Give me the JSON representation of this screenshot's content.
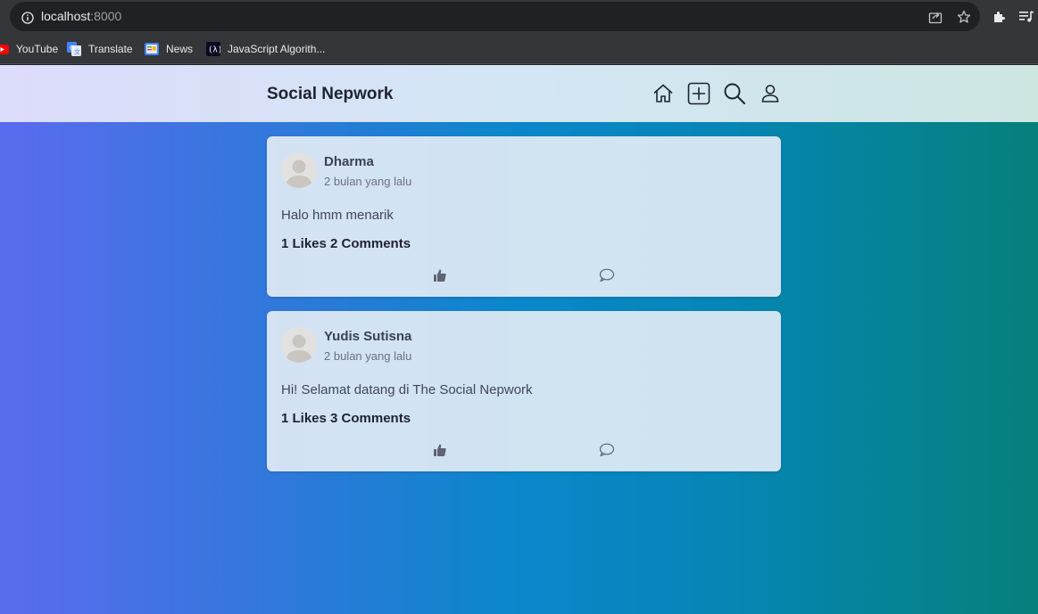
{
  "browser": {
    "url_host": "localhost",
    "url_port": ":8000",
    "bookmarks": [
      {
        "label": "YouTube",
        "icon": "youtube-icon"
      },
      {
        "label": "Translate",
        "icon": "translate-icon"
      },
      {
        "label": "News",
        "icon": "news-icon"
      },
      {
        "label": "JavaScript Algorith...",
        "icon": "freecodecamp-icon"
      }
    ]
  },
  "navbar": {
    "brand": "Social Nepwork",
    "icons": [
      "home-icon",
      "add-post-icon",
      "search-icon",
      "profile-icon"
    ]
  },
  "posts": [
    {
      "author": "Dharma",
      "time": "2 bulan yang lalu",
      "content": "Halo hmm menarik",
      "stats": "1 Likes 2 Comments"
    },
    {
      "author": "Yudis Sutisna",
      "time": "2 bulan yang lalu",
      "content": "Hi! Selamat datang di The Social Nepwork",
      "stats": "1 Likes 3 Comments"
    }
  ],
  "colors": {
    "brand_text": "#1f2330",
    "card_bg": "#e2ecf5",
    "gradient_left": "#5b6bef",
    "gradient_right": "#06807a"
  }
}
